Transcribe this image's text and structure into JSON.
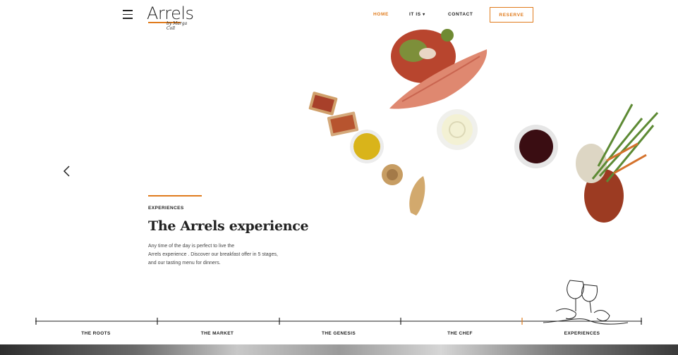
{
  "header": {
    "logo_text": "Arrels",
    "logo_signature": "by Marga Coll",
    "nav": [
      {
        "label": "HOME",
        "active": true
      },
      {
        "label": "IT IS",
        "has_dropdown": true
      },
      {
        "label": "CONTACT"
      }
    ],
    "reserve_label": "RESERVE"
  },
  "hero": {
    "eyebrow": "EXPERIENCES",
    "title": "The Arrels experience",
    "description_lines": [
      "Any time of the day is perfect to live the",
      "Arrels experience . Discover our breakfast offer in 5 stages,",
      "and our tasting menu for dinners."
    ]
  },
  "timeline": {
    "items": [
      "THE ROOTS",
      "THE MARKET",
      "THE GENESIS",
      "THE CHEF",
      "EXPERIENCES"
    ],
    "active_index": 4
  },
  "colors": {
    "accent": "#e07b1c",
    "text": "#222222"
  },
  "icons": {
    "menu": "hamburger-icon",
    "prev": "chevron-left-icon",
    "dropdown": "caret-down-icon"
  }
}
